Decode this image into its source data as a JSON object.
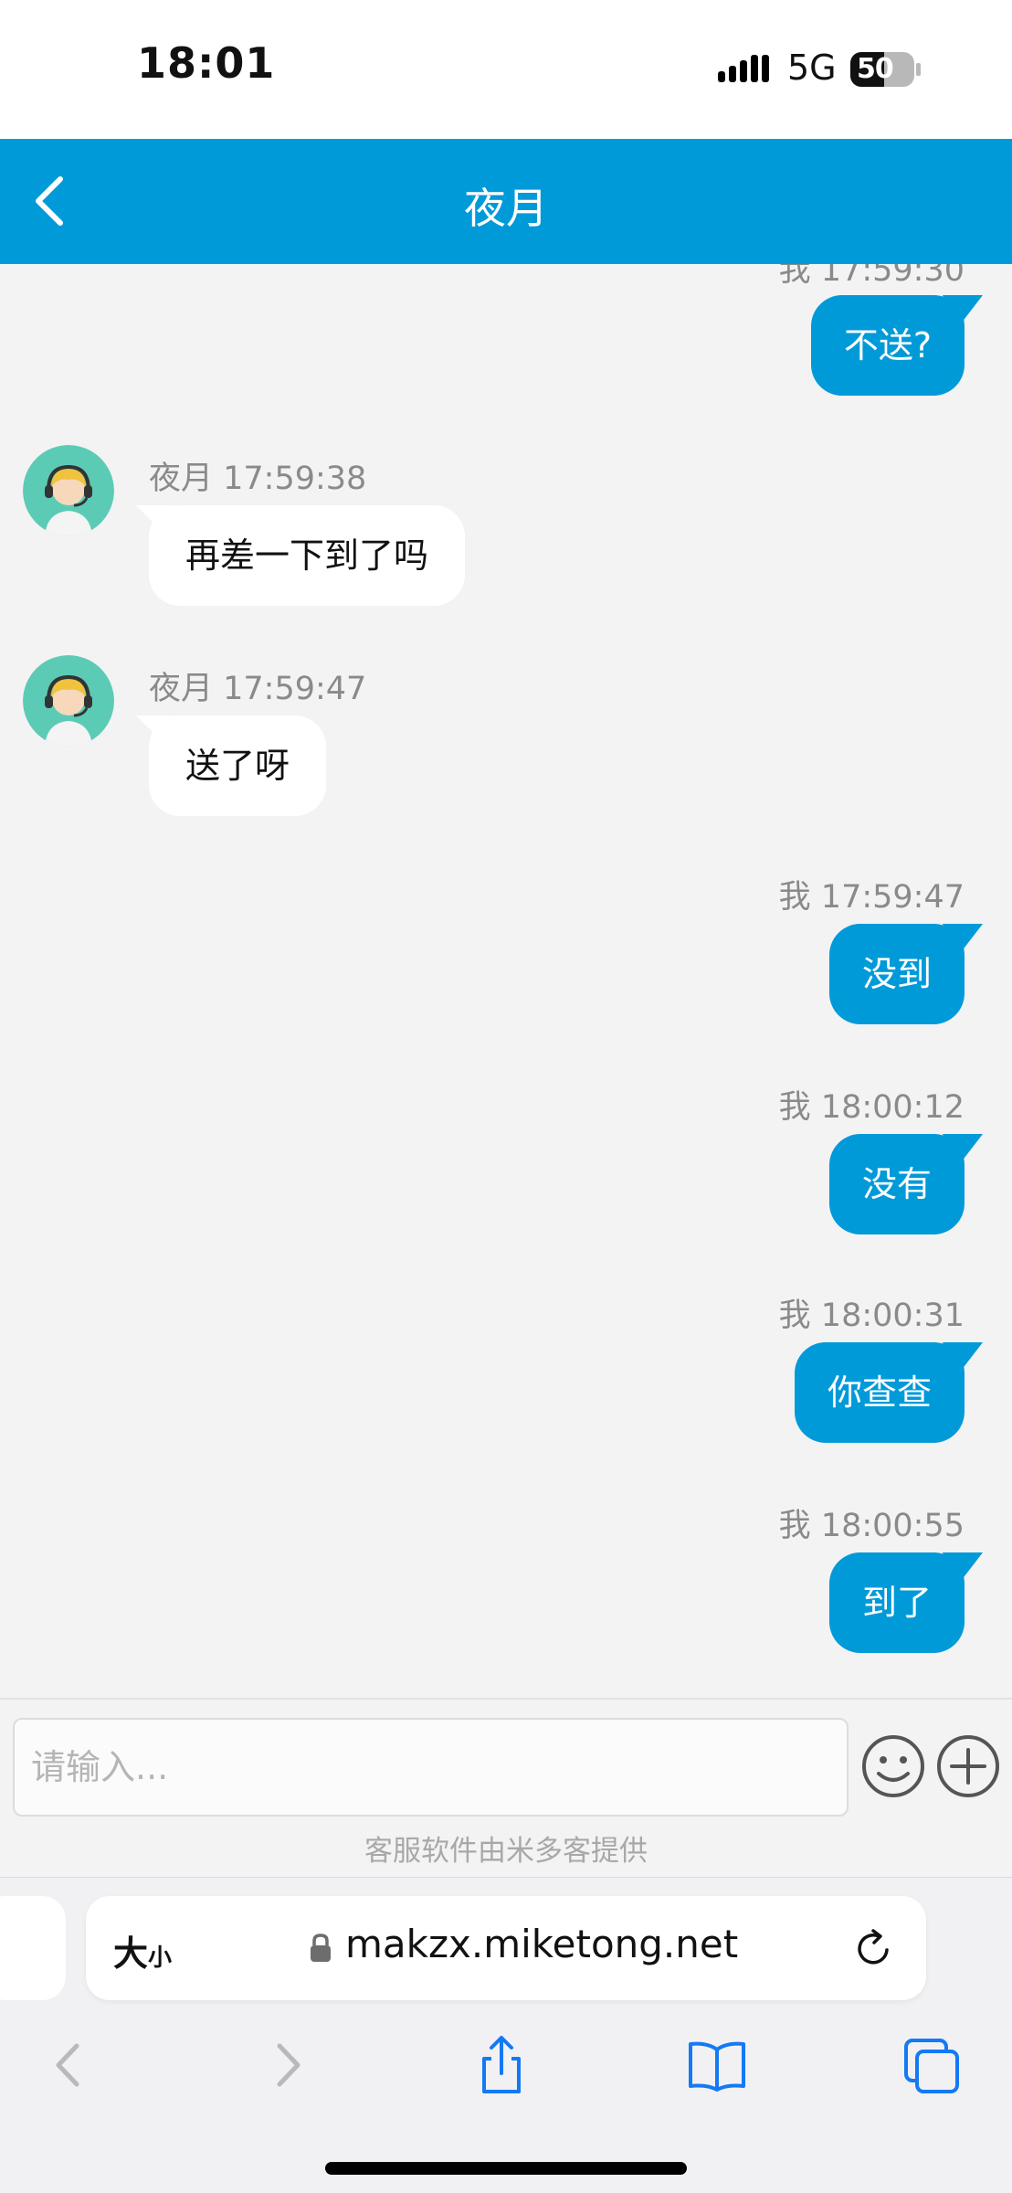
{
  "status_bar": {
    "time": "18:01",
    "network": "5G",
    "battery_level": "50"
  },
  "header": {
    "title": "夜月"
  },
  "messages": [
    {
      "side": "right",
      "meta": "我 17:59:30",
      "text": "不送?",
      "partial": true
    },
    {
      "side": "left",
      "meta": "夜月 17:59:38",
      "text": "再差一下到了吗"
    },
    {
      "side": "left",
      "meta": "夜月 17:59:47",
      "text": "送了呀"
    },
    {
      "side": "right",
      "meta": "我 17:59:47",
      "text": "没到"
    },
    {
      "side": "right",
      "meta": "我 18:00:12",
      "text": "没有"
    },
    {
      "side": "right",
      "meta": "我 18:00:31",
      "text": "你查查"
    },
    {
      "side": "right",
      "meta": "我 18:00:55",
      "text": "到了"
    }
  ],
  "composer": {
    "placeholder": "请输入...",
    "powered_by": "客服软件由米多客提供"
  },
  "browser": {
    "text_size_label": "大",
    "text_size_small": "小",
    "url": "makzx.miketong.net"
  },
  "colors": {
    "accent": "#019ad9",
    "background": "#f3f3f4",
    "bubble_other": "#ffffff",
    "meta_text": "#8a8a8a"
  }
}
